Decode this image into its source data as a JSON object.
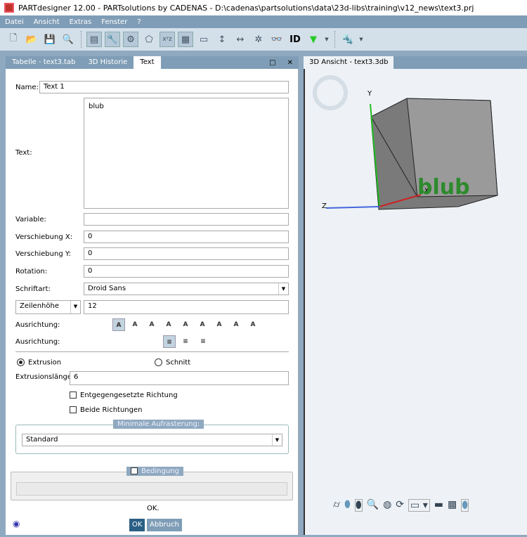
{
  "title": "PARTdesigner 12.00 - PARTsolutions by CADENAS - D:\\cadenas\\partsolutions\\data\\23d-libs\\training\\v12_news\\text3.prj",
  "menu": [
    "Datei",
    "Ansicht",
    "Extras",
    "Fenster",
    "?"
  ],
  "left_tabs": [
    "Tabelle - text3.tab",
    "3D Historie",
    "Text"
  ],
  "right_tab": "3D Ansicht - text3.3db",
  "form": {
    "name_label": "Name:",
    "name_value": "Text 1",
    "text_label": "Text:",
    "text_value": "blub",
    "variable_label": "Variable:",
    "variable_value": "",
    "shift_x_label": "Verschiebung X:",
    "shift_x_value": "0",
    "shift_y_label": "Verschiebung Y:",
    "shift_y_value": "0",
    "rotation_label": "Rotation:",
    "rotation_value": "0",
    "font_label": "Schriftart:",
    "font_value": "Droid Sans",
    "line_height_select": "Zeilenhöhe",
    "line_height_value": "12",
    "anchor_label": "Ausrichtung:",
    "anchor_glyph": "A",
    "align_label": "Ausrichtung:",
    "extrusion_label": "Extrusion",
    "cut_label": "Schnitt",
    "extrusion_length_label": "Extrusionslänge:",
    "extrusion_length_value": "6",
    "opposite_label": "Entgegengesetzte Richtung",
    "both_label": "Beide Richtungen",
    "raster_legend": "Minimale Aufrasterung:",
    "raster_value": "Standard",
    "condition_legend": "Bedingung",
    "status": "OK.",
    "ok": "OK",
    "cancel": "Abbruch"
  },
  "view": {
    "axis_y": "Y",
    "axis_z": "Z",
    "axis_x": "X",
    "model_text": "blub"
  }
}
